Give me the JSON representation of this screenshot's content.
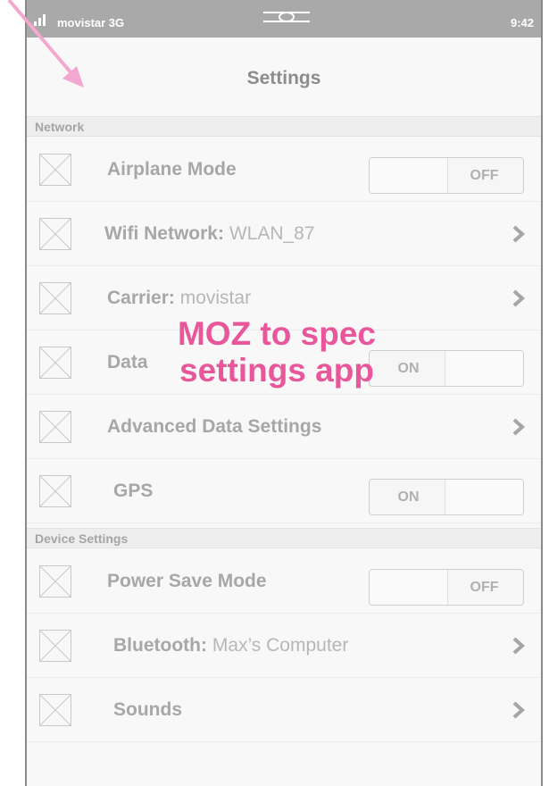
{
  "status_bar": {
    "carrier": "movistar 3G",
    "time": "9:42"
  },
  "nav": {
    "title": "Settings"
  },
  "sections": [
    {
      "header": "Network",
      "rows": [
        {
          "label": "Airplane Mode",
          "control": "toggle",
          "state": "OFF"
        },
        {
          "label": "Wifi Network:",
          "value": "WLAN_87",
          "control": "chevron"
        },
        {
          "label": "Carrier:",
          "value": "movistar",
          "control": "chevron"
        },
        {
          "label": "Data",
          "control": "toggle",
          "state": "ON"
        },
        {
          "label": "Advanced Data Settings",
          "control": "chevron"
        },
        {
          "label": "GPS",
          "control": "toggle",
          "state": "ON"
        }
      ]
    },
    {
      "header": "Device Settings",
      "rows": [
        {
          "label": "Power Save Mode",
          "control": "toggle",
          "state": "OFF"
        },
        {
          "label": "Bluetooth:",
          "value": "Max’s Computer",
          "control": "chevron"
        },
        {
          "label": "Sounds",
          "control": "chevron"
        }
      ]
    }
  ],
  "annotation": {
    "line1": "MOZ to spec",
    "line2": "settings app",
    "color": "#e8579a"
  },
  "icons": {
    "status": [
      "signal-bars-icon",
      "battery-icon"
    ],
    "row": "image-placeholder-icon",
    "disclosure": "chevron-right-icon",
    "pointer": "pink-arrow-icon"
  }
}
